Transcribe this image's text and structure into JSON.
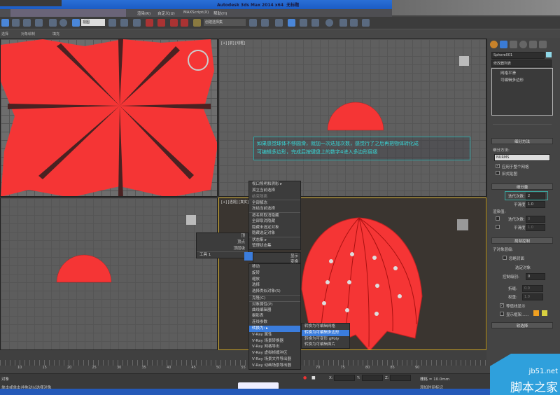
{
  "window": {
    "title": "Autodesk 3ds Max  2014 x64",
    "doc": "无标题"
  },
  "menu": [
    "渲染(R)",
    "自定义(U)",
    "MAXScript(X)",
    "帮助(H)"
  ],
  "toolbar": {
    "view_select": "视图",
    "named_selection": "创建选择集"
  },
  "ribbon": [
    "选择",
    "对象绘制",
    "填充"
  ],
  "viewports": {
    "front_label": "[+] [前] [线框]",
    "persp_label": "[+] [透视] [真实]"
  },
  "note": {
    "line1": "如果感觉球体不够圆滑，就加一次迭加次数，感觉行了之后再把物体转化成",
    "line2": "可编辑多边形，完成后按键盘上的数字4进入多边形层级"
  },
  "context_menu": {
    "top": [
      "视口照明和阴影",
      "孤立当前选择",
      "结束隔离",
      "全部解冻",
      "冻结当前选择",
      "按名称取消隐藏",
      "全部取消隐藏",
      "隐藏未选定对象",
      "隐藏选定对象",
      "状态集",
      "管理状态集"
    ],
    "left_quad": [
      "顶",
      "顶点",
      "顶层级",
      "工具 1"
    ],
    "right_labels": [
      "显示",
      "变换"
    ],
    "bottom": [
      "移动",
      "旋转",
      "缩放",
      "选择",
      "选择类似对象(S)",
      "克隆(C)",
      "对象属性(P)",
      "曲线编辑器",
      "摄影表",
      "连线参数",
      "转换为:",
      "V-Ray 属性",
      "V-Ray 场景转换器",
      "V-Ray 网格导出",
      "V-Ray 虚拟帧缓冲区",
      "V-Ray 场景文件导出器",
      "V-Ray 动画场景导出器"
    ],
    "submenu": [
      "转换为可编辑网格",
      "转换为可编辑多边形",
      "转换为可变形 gPoly",
      "转换为可编辑面片"
    ]
  },
  "command_panel": {
    "object_name": "Sphere001",
    "modifier_list": "修改器列表",
    "stack": [
      "网格平滑",
      "可编辑多边形"
    ],
    "subdiv_method": {
      "title": "细分方法",
      "label": "细分方法:",
      "value": "NURMS",
      "apply_whole": "应用于整个网格",
      "old_map": "旧式贴图"
    },
    "subdiv_amount": {
      "title": "细分量",
      "iterations_label": "迭代次数:",
      "iterations": "2",
      "smoothness_label": "平滑度:",
      "smoothness": "1.0",
      "render_label": "渲染值:",
      "r_iterations": "0",
      "r_smoothness": "1.0"
    },
    "local": {
      "title": "局部控制",
      "sublevel": "子对象层级:",
      "ignore_back": "忽略背面",
      "selected": "选定对象",
      "ctrl_level_label": "控制级别:",
      "ctrl_level": "0",
      "crease_label": "折缝:",
      "crease": "0.0",
      "weight_label": "权重:",
      "weight": "1.0",
      "isoline": "等值线显示",
      "show_cage": "显示框架......"
    },
    "soft_select": "软选择"
  },
  "timeline": {
    "ticks": [
      "10",
      "15",
      "20",
      "25",
      "30",
      "35",
      "40",
      "45",
      "50",
      "55",
      "60",
      "65",
      "70",
      "75",
      "80",
      "85",
      "90"
    ]
  },
  "status": {
    "left1": "对象",
    "left2": "单击或单击并拖动以选择对象",
    "x": "X:",
    "y": "Y:",
    "z": "Z:",
    "grid": "栅格 = 10.0mm",
    "add_time_tag": "添加时间标记"
  },
  "watermark": {
    "url": "jb51.net",
    "name": "脚本之家"
  },
  "colors": {
    "mesh": "#ff3a3a",
    "highlight": "#3b7ddd",
    "note": "#37d7d7"
  }
}
